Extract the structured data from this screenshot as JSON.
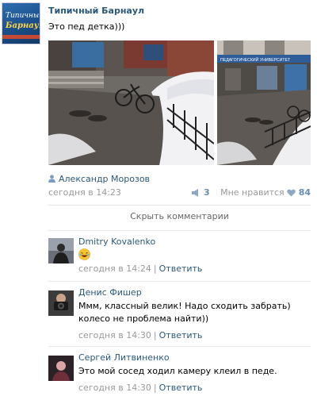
{
  "post": {
    "group_name": "Типичный Барнаул",
    "group_avatar_line1": "Типичный",
    "group_avatar_line2": "Барнаул",
    "text": "Это пед детка)))",
    "author": "Александр Морозов",
    "date": "сегодня в 14:23",
    "repost_count": "3",
    "like_label": "Мне нравится",
    "like_count": "84",
    "colors": {
      "link": "#2b587a",
      "meta": "#999999",
      "accent": "#6b8eb4"
    },
    "photo2_sign": "ПЕДАГОГИЧЕСКИЙ УНИВЕРСИТЕТ"
  },
  "comments_toggle": "Скрыть комментарии",
  "comments": [
    {
      "name": "Dmitry Kovalenko",
      "text": "",
      "emoji": "laughing-emoji",
      "date": "сегодня в 14:24",
      "reply": "Ответить"
    },
    {
      "name": "Денис Фишер",
      "text": "Ммм, классный велик! Надо сходить забрать) колесо не проблема найти))",
      "date": "сегодня в 14:30",
      "reply": "Ответить"
    },
    {
      "name": "Сергей Литвиненко",
      "text": "Это мой сосед ходил камеру клеил в педе.",
      "date": "сегодня в 14:30",
      "reply": "Ответить"
    }
  ],
  "separator": "|"
}
